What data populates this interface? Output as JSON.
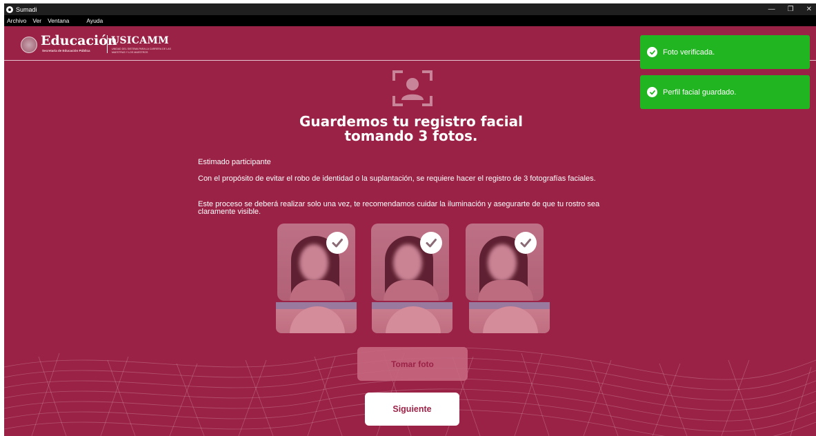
{
  "window": {
    "title": "Sumadi",
    "controls": {
      "minimize": "—",
      "restore": "❐",
      "close": "✕"
    }
  },
  "menu": [
    "Archivo",
    "Ver",
    "Ventana",
    "Ayuda"
  ],
  "header": {
    "logo_main": "Educación",
    "logo_main_sub": "Secretaría de Educación Pública",
    "logo_secondary": "USICAMM",
    "logo_secondary_sub": "UNIDAD DEL SISTEMA PARA LA CARRERA DE LAS MAESTRAS Y LOS MAESTROS"
  },
  "main": {
    "icon": "face-frame-icon",
    "title_line1": "Guardemos tu registro facial",
    "title_line2": "tomando 3 fotos.",
    "greeting": "Estimado participante",
    "paragraph1": "Con el propósito de evitar el robo de identidad o la suplantación, se requiere hacer el registro de 3 fotografías faciales.",
    "paragraph2": "Este proceso se deberá realizar solo una vez, te recomendamos cuidar la iluminación y asegurarte de que tu rostro sea claramente visible.",
    "photos": [
      {
        "status": "verified"
      },
      {
        "status": "verified"
      },
      {
        "status": "verified"
      }
    ],
    "take_photo_button": "Tomar foto",
    "next_button": "Siguiente"
  },
  "toasts": [
    {
      "message": "Foto verificada.",
      "icon": "check-circle-icon"
    },
    {
      "message": "Perfil facial guardado.",
      "icon": "check-circle-icon"
    }
  ],
  "colors": {
    "brand": "#9b2247",
    "toast_success": "#22b522",
    "titlebar": "#1f1f1f",
    "menubar": "#000000"
  }
}
